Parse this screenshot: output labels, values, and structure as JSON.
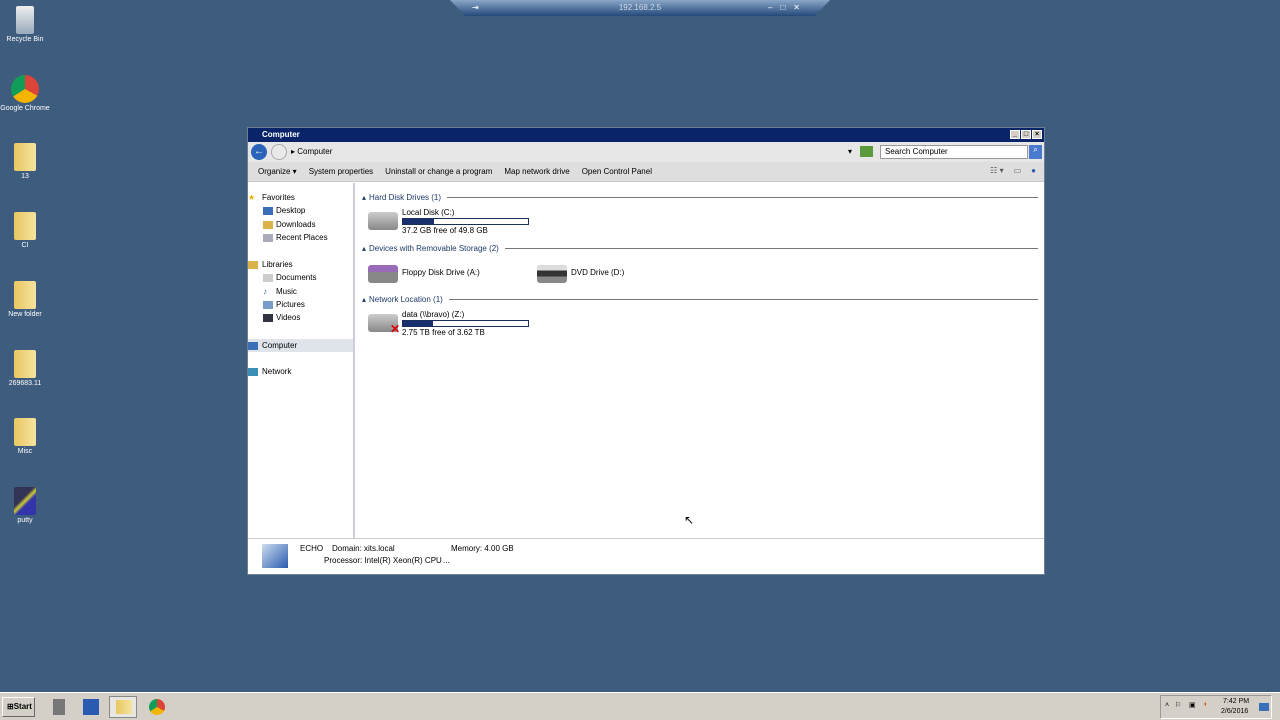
{
  "rdp_bar": {
    "host": "192.168.2.5"
  },
  "desktop": [
    {
      "label": "Recycle Bin",
      "icon": "recycle-bin-icon"
    },
    {
      "label": "Google Chrome",
      "icon": "chrome-icon"
    },
    {
      "label": "13",
      "icon": "folder-icon"
    },
    {
      "label": "CI",
      "icon": "folder-icon"
    },
    {
      "label": "New folder",
      "icon": "folder-icon"
    },
    {
      "label": "269683.11",
      "icon": "folder-icon"
    },
    {
      "label": "Misc",
      "icon": "folder-icon"
    },
    {
      "label": "putty",
      "icon": "putty-icon"
    }
  ],
  "window": {
    "title": "Computer",
    "address": "Computer",
    "search_placeholder": "Search Computer",
    "toolbar": [
      "Organize ▾",
      "System properties",
      "Uninstall or change a program",
      "Map network drive",
      "Open Control Panel"
    ],
    "nav": {
      "favorites": "Favorites",
      "fav_items": [
        "Desktop",
        "Downloads",
        "Recent Places"
      ],
      "libraries": "Libraries",
      "lib_items": [
        "Documents",
        "Music",
        "Pictures",
        "Videos"
      ],
      "computer": "Computer",
      "network": "Network"
    },
    "groups": {
      "hdd": "Hard Disk Drives (1)",
      "removable": "Devices with Removable Storage (2)",
      "network": "Network Location (1)"
    },
    "drives": {
      "c": {
        "name": "Local Disk (C:)",
        "free": "37.2 GB free of 49.8 GB",
        "used_fraction": 0.25
      },
      "a": {
        "name": "Floppy Disk Drive (A:)"
      },
      "d": {
        "name": "DVD Drive (D:)"
      },
      "z": {
        "name": "data (\\\\bravo) (Z:)",
        "free": "2.75 TB free of 3.62 TB",
        "used_fraction": 0.24
      }
    },
    "details": {
      "name": "ECHO",
      "domain": "Domain: xits.local",
      "memory": "Memory: 4.00 GB",
      "processor": "Processor: Intel(R) Xeon(R) CPU",
      "ellipsis": "..."
    }
  },
  "taskbar": {
    "start": "Start",
    "time": "7:42 PM",
    "date": "2/6/2016"
  }
}
